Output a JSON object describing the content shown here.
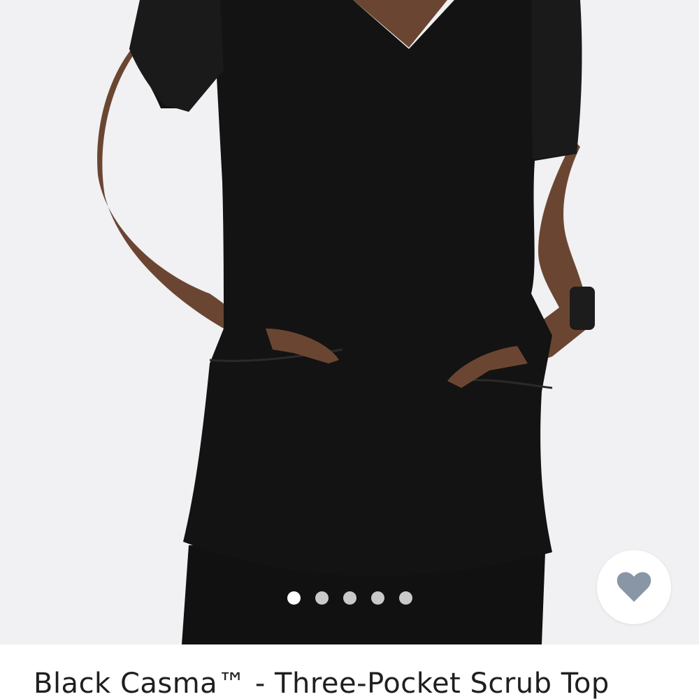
{
  "product": {
    "title": "Black Casma™ - Three-Pocket Scrub Top",
    "image_alt": "Model wearing black three-pocket scrub top with hands in pockets"
  },
  "carousel": {
    "count": 5,
    "active_index": 0
  },
  "favorite": {
    "icon": "heart-icon",
    "icon_color": "#8896a5"
  },
  "colors": {
    "background": "#f1f0f2",
    "garment": "#131313",
    "title_text": "#1f1f1f"
  }
}
